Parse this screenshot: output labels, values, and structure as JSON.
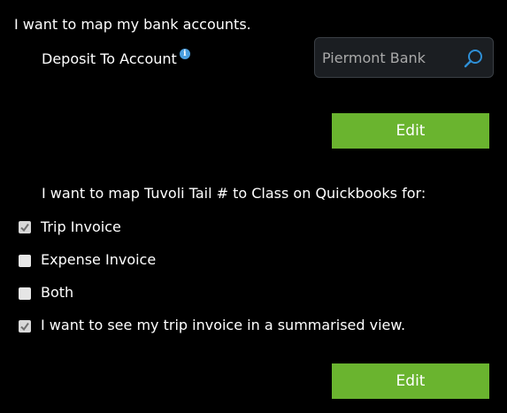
{
  "bank": {
    "heading": "I want to map my bank accounts.",
    "deposit_label": "Deposit To Account",
    "info_icon": "info-icon",
    "search": {
      "value": "Piermont Bank",
      "icon": "search-icon"
    },
    "edit_label": "Edit"
  },
  "class_mapping": {
    "heading": "I want to map Tuvoli Tail # to Class on Quickbooks for:",
    "options": [
      {
        "label": "Trip Invoice",
        "checked": true
      },
      {
        "label": "Expense Invoice",
        "checked": false
      },
      {
        "label": "Both",
        "checked": false
      },
      {
        "label": "I want to see my trip invoice in a summarised view.",
        "checked": true
      }
    ],
    "edit_label": "Edit"
  },
  "colors": {
    "background": "#000000",
    "button": "#6ab42f",
    "info_icon": "#4a9fe0",
    "search_icon": "#2e8fd6",
    "input_background": "#1b1e22"
  }
}
